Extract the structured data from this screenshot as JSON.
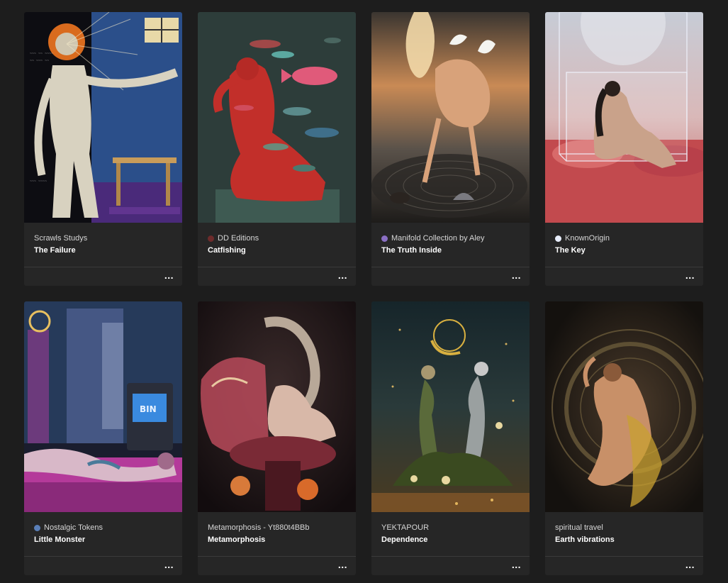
{
  "cards": [
    {
      "collection": "Scrawls Studys",
      "title": "The Failure",
      "icon": "none",
      "icon_color": "",
      "more_label": "..."
    },
    {
      "collection": "DD Editions",
      "title": "Catfishing",
      "icon": "collection-avatar-icon",
      "icon_color": "#6e2b2b",
      "more_label": "..."
    },
    {
      "collection": "Manifold Collection by Aley",
      "title": "The Truth Inside",
      "icon": "collection-avatar-icon",
      "icon_color": "#8a6fc4",
      "more_label": "..."
    },
    {
      "collection": "KnownOrigin",
      "title": "The Key",
      "icon": "collection-avatar-icon",
      "icon_color": "#e8eefc",
      "more_label": "..."
    },
    {
      "collection": "Nostalgic Tokens",
      "title": "Little Monster",
      "icon": "collection-avatar-icon",
      "icon_color": "#5a7fb8",
      "more_label": "..."
    },
    {
      "collection": "Metamorphosis - Yt880t4BBb",
      "title": "Metamorphosis",
      "icon": "none",
      "icon_color": "",
      "more_label": "..."
    },
    {
      "collection": "YEKTAPOUR",
      "title": "Dependence",
      "icon": "none",
      "icon_color": "",
      "more_label": "..."
    },
    {
      "collection": "spiritual travel",
      "title": "Earth vibrations",
      "icon": "none",
      "icon_color": "",
      "more_label": "..."
    }
  ],
  "colors": {
    "page_background": "#1d1d1d",
    "card_background": "#262626",
    "divider": "#3a3a3a"
  }
}
